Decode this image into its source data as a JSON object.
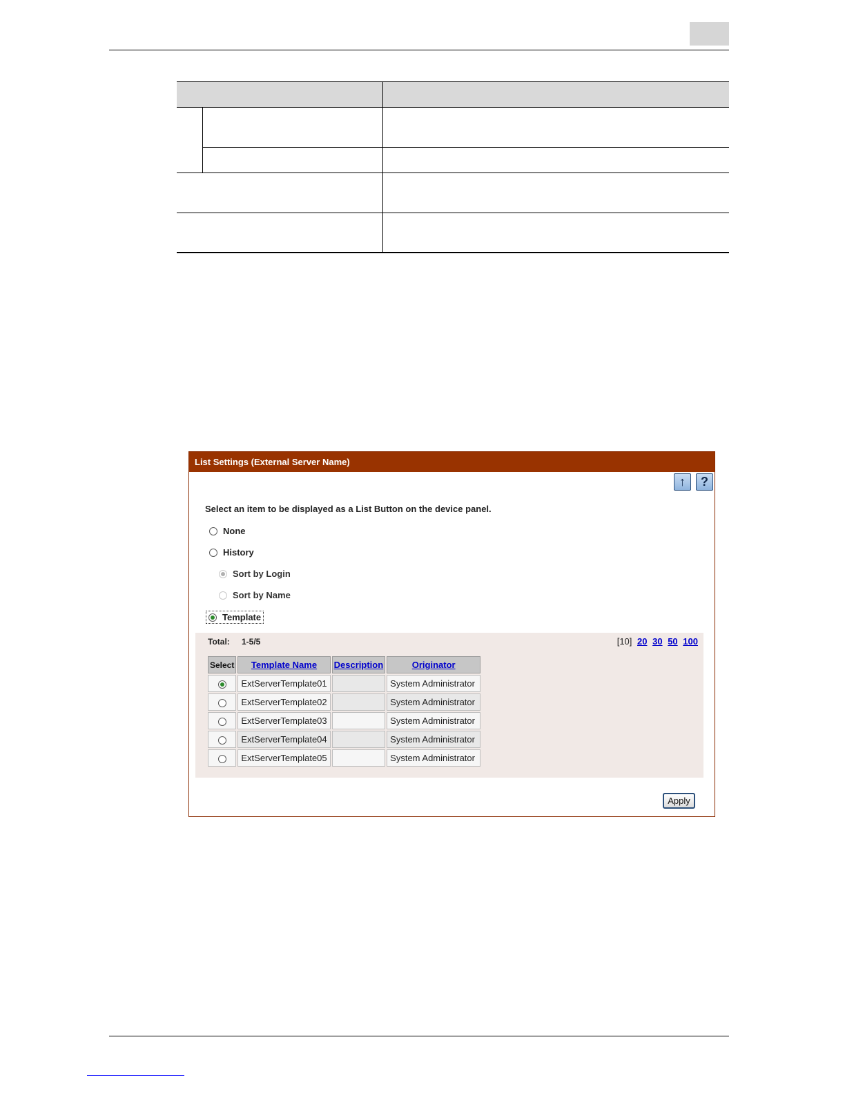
{
  "dialog": {
    "title": "List Settings (External Server Name)",
    "icons": {
      "up": "↑",
      "help": "?"
    },
    "instruction": "Select an item to be displayed as a List Button on the device panel.",
    "options": {
      "none": "None",
      "history": "History",
      "sort_by_login": "Sort by Login",
      "sort_by_name": "Sort by Name",
      "template": "Template"
    },
    "selected_option": "Template",
    "list": {
      "total_label": "Total:",
      "total_value": "1-5/5",
      "page_size_current": "[10]",
      "page_sizes": [
        "20",
        "30",
        "50",
        "100"
      ],
      "columns": [
        "Select",
        "Template Name",
        "Description",
        "Originator"
      ],
      "rows": [
        {
          "name": "ExtServerTemplate01",
          "description": "",
          "originator": "System Administrator",
          "selected": true
        },
        {
          "name": "ExtServerTemplate02",
          "description": "",
          "originator": "System Administrator",
          "selected": false
        },
        {
          "name": "ExtServerTemplate03",
          "description": "",
          "originator": "System Administrator",
          "selected": false
        },
        {
          "name": "ExtServerTemplate04",
          "description": "",
          "originator": "System Administrator",
          "selected": false
        },
        {
          "name": "ExtServerTemplate05",
          "description": "",
          "originator": "System Administrator",
          "selected": false
        }
      ]
    },
    "apply_label": "Apply"
  }
}
